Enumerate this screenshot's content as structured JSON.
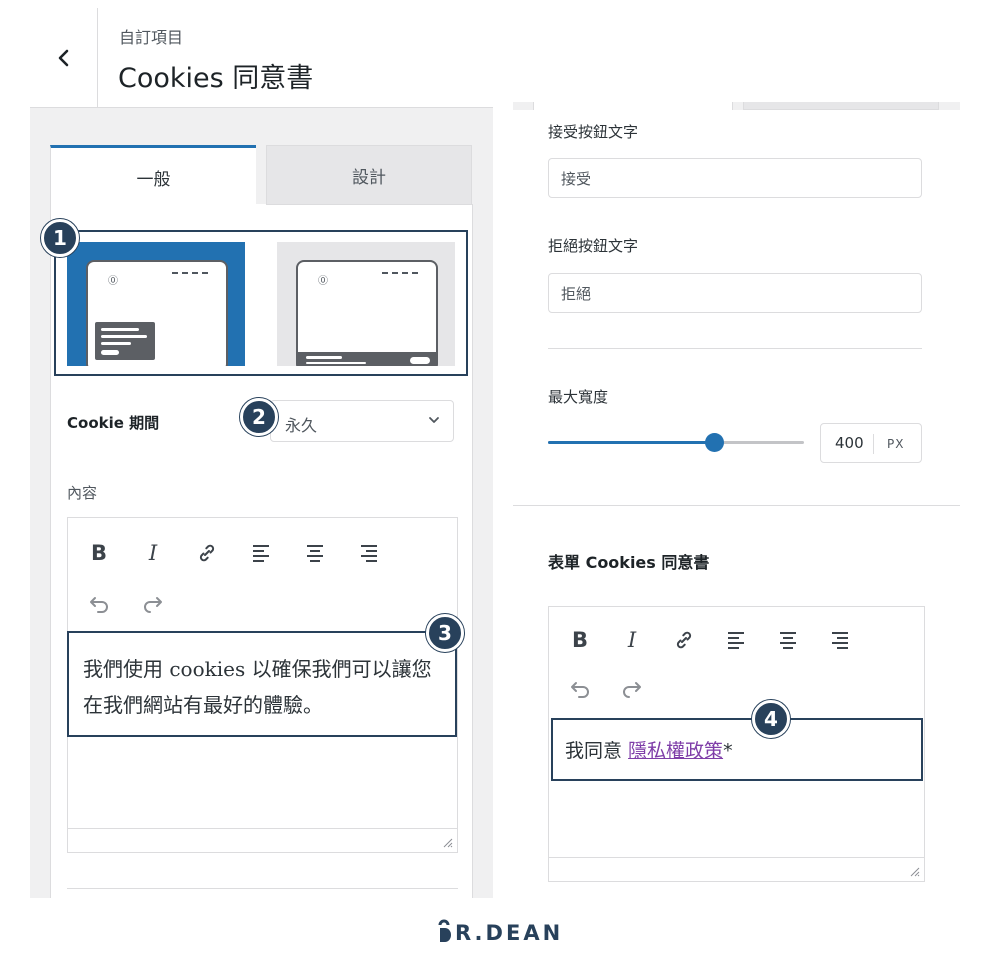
{
  "colors": {
    "accent": "#2271b1",
    "annotation": "#28415b",
    "link": "#7e3da8",
    "panel_bg": "#f0f0f1"
  },
  "header": {
    "back_icon": "chevron-left-icon",
    "breadcrumb": "自訂項目",
    "title": "Cookies 同意書"
  },
  "tabs": [
    {
      "label": "一般",
      "active": true
    },
    {
      "label": "設計",
      "active": false
    }
  ],
  "layout_options": [
    {
      "name": "popup-layout",
      "selected": true
    },
    {
      "name": "bar-layout",
      "selected": false
    }
  ],
  "cookie_period": {
    "label": "Cookie 期間",
    "value": "永久"
  },
  "content": {
    "label": "內容",
    "text": "我們使用 cookies 以確保我們可以讓您在我們網站有最好的體驗。"
  },
  "toolbar": {
    "bold": "B",
    "italic": "I",
    "icons": [
      "link-icon",
      "align-left-icon",
      "align-center-icon",
      "align-right-icon",
      "undo-icon",
      "redo-icon"
    ]
  },
  "accept_button": {
    "label": "接受按鈕文字",
    "value": "接受"
  },
  "decline_button": {
    "label": "拒絕按鈕文字",
    "value": "拒絕"
  },
  "max_width": {
    "label": "最大寬度",
    "value": "400",
    "unit": "PX",
    "fraction": 0.65
  },
  "form_consent": {
    "title": "表單 Cookies 同意書",
    "prefix": "我同意 ",
    "link_text": "隱私權政策",
    "suffix": "*"
  },
  "badges": [
    "1",
    "2",
    "3",
    "4"
  ],
  "brand": {
    "text": "R.DEAN"
  }
}
